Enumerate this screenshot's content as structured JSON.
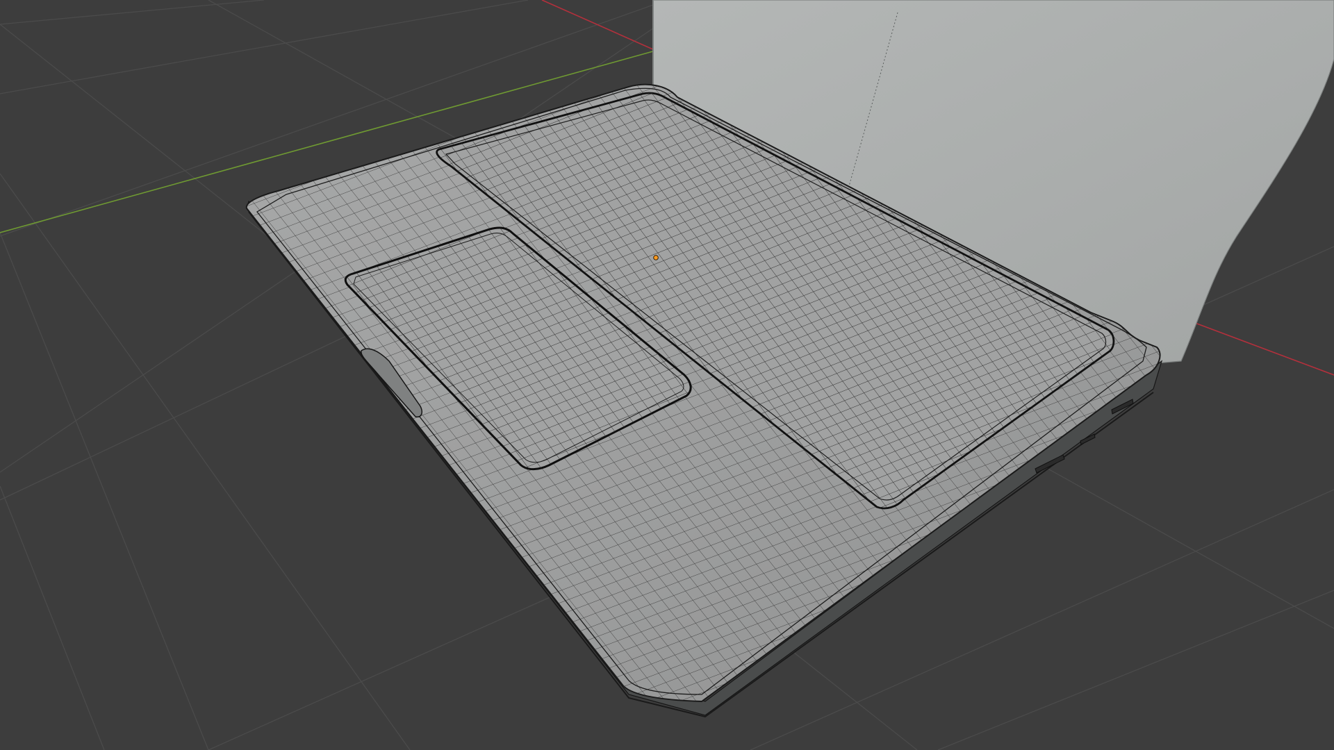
{
  "viewport": {
    "background_color": "#3d3d3d",
    "grid_color": "#4a4a4a",
    "x_axis_color": "#b3303c",
    "y_axis_color": "#6f9a32",
    "wire_color": "#1c1c1c",
    "surface_color": "#9fa0a0",
    "lid_color": "#a9acab",
    "origin_color": "#ff9a1f"
  },
  "scene": {
    "object": "laptop-base-mesh",
    "shading": "solid-with-wireframe-overlay"
  }
}
